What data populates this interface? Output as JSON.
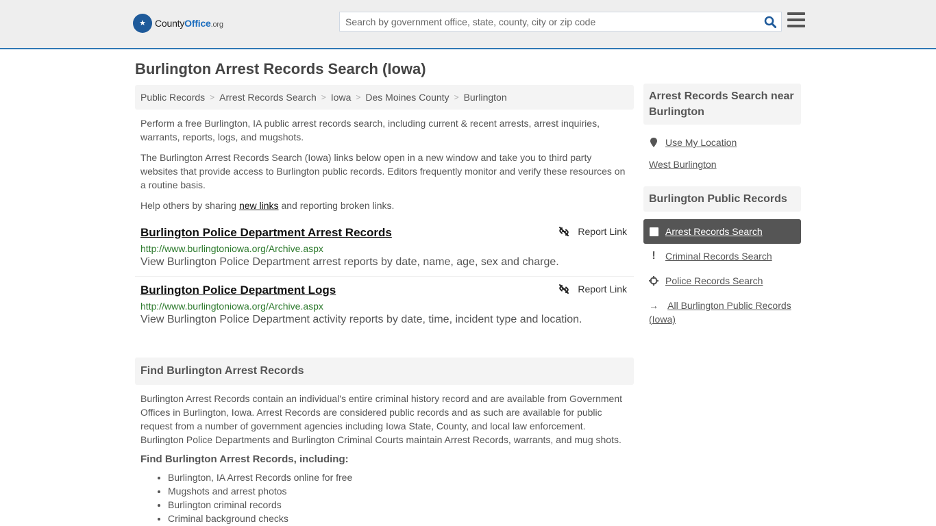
{
  "header": {
    "logo": {
      "name": "County",
      "bold": "Office",
      "tld": ".org"
    },
    "search_placeholder": "Search by government office, state, county, city or zip code",
    "search_value": ""
  },
  "page_title": "Burlington Arrest Records Search (Iowa)",
  "breadcrumb": [
    "Public Records",
    "Arrest Records Search",
    "Iowa",
    "Des Moines County",
    "Burlington"
  ],
  "intro": {
    "p1": "Perform a free Burlington, IA public arrest records search, including current & recent arrests, arrest inquiries, warrants, reports, logs, and mugshots.",
    "p2": "The Burlington Arrest Records Search (Iowa) links below open in a new window and take you to third party websites that provide access to Burlington public records. Editors frequently monitor and verify these resources on a routine basis.",
    "p3_before": "Help others by sharing ",
    "p3_link": "new links",
    "p3_after": " and reporting broken links."
  },
  "results": [
    {
      "title": "Burlington Police Department Arrest Records",
      "url": "http://www.burlingtoniowa.org/Archive.aspx",
      "description": "View Burlington Police Department arrest reports by date, name, age, sex and charge.",
      "report_label": "Report Link"
    },
    {
      "title": "Burlington Police Department Logs",
      "url": "http://www.burlingtoniowa.org/Archive.aspx",
      "description": "View Burlington Police Department activity reports by date, time, incident type and location.",
      "report_label": "Report Link"
    }
  ],
  "find_section": {
    "heading": "Find Burlington Arrest Records",
    "body": "Burlington Arrest Records contain an individual's entire criminal history record and are available from Government Offices in Burlington, Iowa. Arrest Records are considered public records and as such are available for public request from a number of government agencies including Iowa State, County, and local law enforcement. Burlington Police Departments and Burlington Criminal Courts maintain Arrest Records, warrants, and mug shots.",
    "subheading": "Find Burlington Arrest Records, including:",
    "items": [
      "Burlington, IA Arrest Records online for free",
      "Mugshots and arrest photos",
      "Burlington criminal records",
      "Criminal background checks"
    ]
  },
  "sidebar": {
    "near_heading": "Arrest Records Search near Burlington",
    "use_location": "Use My Location",
    "nearby": [
      "West Burlington"
    ],
    "public_heading": "Burlington Public Records",
    "links": [
      {
        "label": "Arrest Records Search",
        "icon": "square-icon",
        "active": true
      },
      {
        "label": "Criminal Records Search",
        "icon": "exclamation-icon",
        "active": false
      },
      {
        "label": "Police Records Search",
        "icon": "crosshair-icon",
        "active": false
      },
      {
        "label": "All Burlington Public Records (Iowa)",
        "icon": "arrow-right-icon",
        "active": false
      }
    ]
  },
  "colors": {
    "accent": "#2f78b5",
    "url_green": "#2d7a2d",
    "active_bg": "#555555"
  }
}
